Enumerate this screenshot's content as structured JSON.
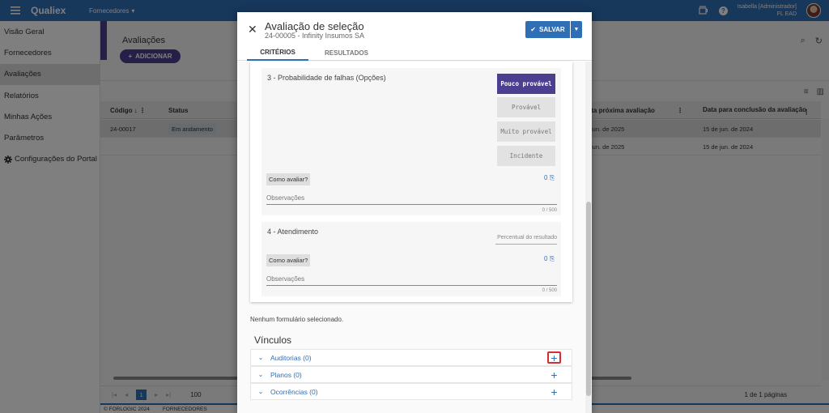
{
  "topbar": {
    "brand": "Qualiex",
    "module": "Fornecedores",
    "user_name": "Isabella [Administrador]",
    "user_org": "FL EAD",
    "help_glyph": "?",
    "icons": [
      "menu-icon",
      "coffee-icon",
      "help-icon",
      "avatar"
    ]
  },
  "sidebar": {
    "items": [
      {
        "label": "Visão Geral"
      },
      {
        "label": "Fornecedores"
      },
      {
        "label": "Avaliações",
        "active": true
      },
      {
        "label": "Relatórios"
      },
      {
        "label": "Minhas Ações"
      },
      {
        "label": "Parâmetros"
      },
      {
        "label": "Configurações do Portal",
        "icon": "gear-icon"
      }
    ]
  },
  "background": {
    "title": "Avaliações",
    "add_label": "ADICIONAR",
    "columns": [
      "Código",
      "Status",
      "Data próxima avaliação",
      "Data para conclusão da avaliação"
    ],
    "rows": [
      {
        "codigo": "24-00017",
        "status": "Em andamento",
        "proxima": "jun. de 2025",
        "conclusao": "15 de jun. de 2024"
      },
      {
        "codigo": "",
        "status": "",
        "proxima": "jun. de 2025",
        "conclusao": "15 de jun. de 2024"
      }
    ],
    "pager": {
      "current_page": "1",
      "page_size": "100",
      "page_count": "1 de 1 páginas"
    },
    "footer": {
      "copyright": "© FORLOGIC 2024",
      "module": "FORNECEDORES"
    }
  },
  "modal": {
    "title": "Avaliação de seleção",
    "subtitle": "24-00005 - Infinity Insumos SA",
    "save_label": "SALVAR",
    "tabs": [
      {
        "label": "CRITÉRIOS",
        "active": true
      },
      {
        "label": "RESULTADOS",
        "active": false
      }
    ],
    "questions": [
      {
        "title": "3 - Probabilidade de falhas (Opções)",
        "options": [
          {
            "label": "Pouco provável",
            "selected": true
          },
          {
            "label": "Provável",
            "selected": false
          },
          {
            "label": "Muito provável",
            "selected": false
          },
          {
            "label": "Incidente",
            "selected": false
          }
        ],
        "how_label": "Como avaliar?",
        "attachments": "0",
        "observations_placeholder": "Observações",
        "char_count": "0 / 500"
      },
      {
        "title": "4 - Atendimento",
        "result_placeholder": "Percentual do resultado",
        "how_label": "Como avaliar?",
        "attachments": "0",
        "observations_placeholder": "Observações",
        "char_count": "0 / 500"
      }
    ],
    "no_form": "Nenhum formulário selecionado.",
    "vinculos_title": "Vínculos",
    "vinculos": [
      {
        "label": "Auditorias (0)",
        "highlighted": true
      },
      {
        "label": "Planos (0)",
        "highlighted": false
      },
      {
        "label": "Ocorrências (0)",
        "highlighted": false
      }
    ]
  },
  "colors": {
    "primary": "#2f6fb6",
    "accent": "#4c3f8f",
    "highlight": "#d32f2f"
  }
}
